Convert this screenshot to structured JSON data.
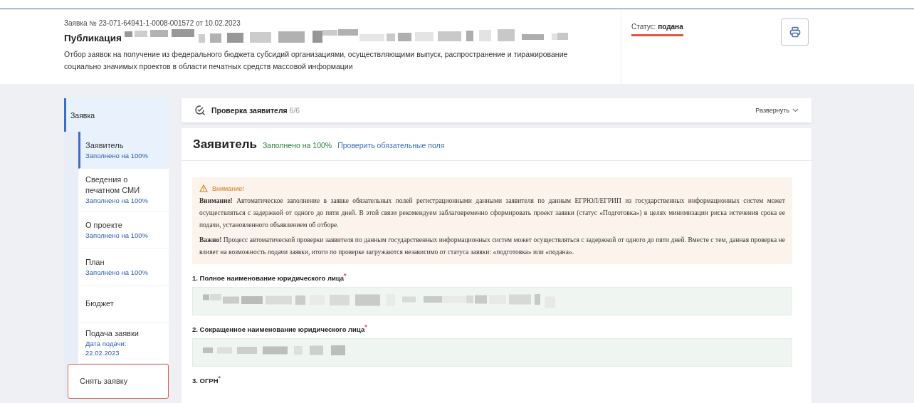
{
  "header": {
    "number": "Заявка № 23-071-64941-1-0008-001572 от 10.02.2023",
    "title": "Публикация",
    "title_redacted": true,
    "description": "Отбор заявок на получение из федерального бюджета субсидий организациями, осуществляющими выпуск, распространение и тиражирование социально значимых проектов в области печатных средств массовой информации",
    "status_label": "Статус:",
    "status_value": "подана"
  },
  "sidebar": {
    "items": [
      {
        "label": "Заявка",
        "selected": true,
        "children": [
          {
            "label": "Заявитель",
            "note": "Заполнено на 100%",
            "selected": true,
            "kind": "nav"
          },
          {
            "label": "Сведения о печатном СМИ",
            "note": "Заполнено на 100%",
            "selected": false,
            "kind": "nav"
          },
          {
            "label": "О проекте",
            "note": "Заполнено на 100%",
            "selected": false,
            "kind": "nav"
          },
          {
            "label": "План",
            "note": "Заполнено на 100%",
            "selected": false,
            "kind": "nav"
          },
          {
            "label": "Бюджет",
            "selected": false,
            "kind": "nav"
          },
          {
            "label": "Подача заявки",
            "note": "Дата подачи: 22.02.2023",
            "selected": false,
            "kind": "nav"
          },
          {
            "label": "Снять заявку",
            "selected": false,
            "kind": "danger"
          }
        ]
      }
    ]
  },
  "check_bar": {
    "title": "Проверка заявителя",
    "count": "6/6",
    "expand": "Развернуть"
  },
  "section": {
    "title": "Заявитель",
    "progress": "Заполнено на 100%",
    "complete": true,
    "link": "Проверить обязательные поля",
    "warning": {
      "title": "Внимание!",
      "paragraphs": [
        "**Внимание!** Автоматическое заполнение в заявке обязательных полей регистрационными данными заявителя по данным ЕГРЮЛ/ЕГРИП из государственных информационных систем может осуществляться с задержкой от одного до пяти дней. В этой связи рекомендуем заблаговременно сформировать проект заявки (статус «Подготовка») в целях минимизации риска истечения срока ее подачи, установленного объявлением об отборе.",
        "**Важно!** Процесс автоматической проверки заявителя по данным государственных информационных систем может осуществляться с задержкой от одного до пяти дней. Вместе с тем, данная проверка не влияет на возможность подачи заявки, итоги по проверке загружаются независимо от статуса заявки: «подготовка» или «подана»."
      ]
    },
    "fields": [
      {
        "label": "1. Полное наименование юридического лица",
        "required_mark": "*",
        "redacted": true
      },
      {
        "label": "2. Сокращенное наименование юридического лица",
        "required_mark": "*",
        "redacted": true
      },
      {
        "label": "3. ОГРН",
        "required_mark": "*"
      }
    ]
  }
}
